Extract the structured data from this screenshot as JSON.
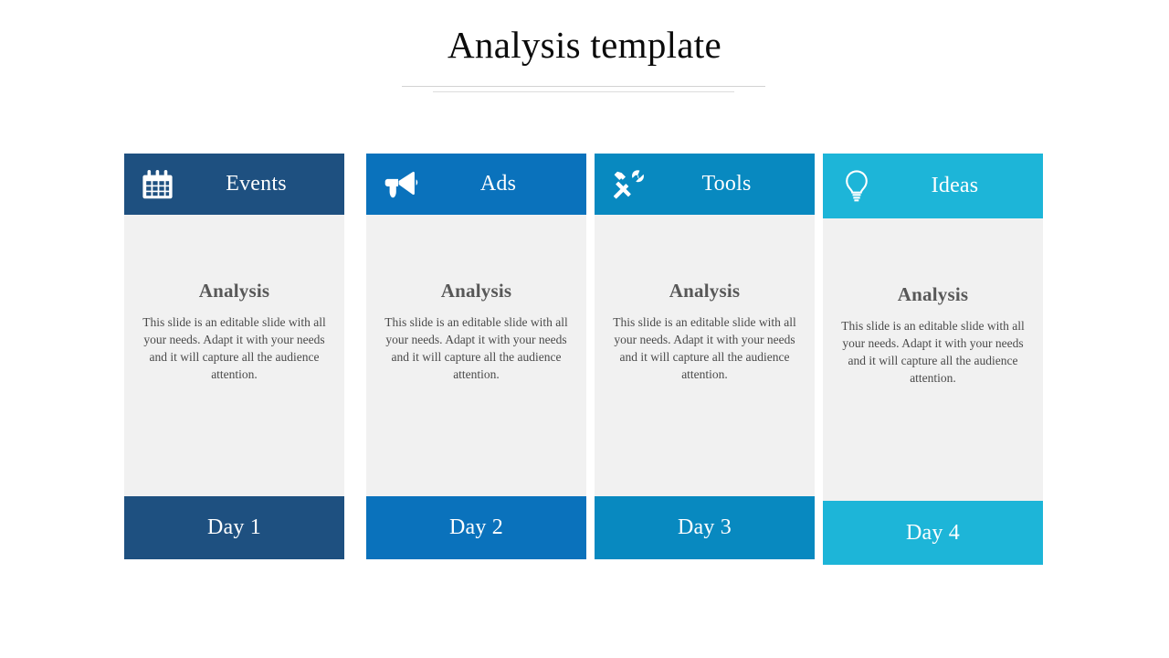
{
  "slide": {
    "title": "Analysis template",
    "background_color": "#FFFFFF",
    "rule_color": "#D2D2D2"
  },
  "cards": [
    {
      "header_label": "Events",
      "icon": "calendar-icon",
      "header_color": "#1E5080",
      "body_color": "#F1F1F1",
      "footer_color": "#1E5080",
      "body_heading": "Analysis",
      "body_text": "This slide is an editable slide with all your needs. Adapt it with your needs and it will capture all the audience attention.",
      "footer_label": "Day 1"
    },
    {
      "header_label": "Ads",
      "icon": "megaphone-icon",
      "header_color": "#0A72BC",
      "body_color": "#F1F1F1",
      "footer_color": "#0A72BC",
      "body_heading": "Analysis",
      "body_text": "This slide is an editable slide with all your needs. Adapt it with your needs and it will capture all the audience attention.",
      "footer_label": "Day 2"
    },
    {
      "header_label": "Tools",
      "icon": "hammer-wrench-icon",
      "header_color": "#0889C0",
      "body_color": "#F1F1F1",
      "footer_color": "#0889C0",
      "body_heading": "Analysis",
      "body_text": "This slide is an editable slide with all your needs. Adapt it with your needs and it will capture all the audience attention.",
      "footer_label": "Day 3"
    },
    {
      "header_label": "Ideas",
      "icon": "lightbulb-icon",
      "header_color": "#1DB5D8",
      "body_color": "#F1F1F1",
      "footer_color": "#1DB5D8",
      "body_heading": "Analysis",
      "body_text": "This slide is an editable slide with all your needs. Adapt it with your needs and it will capture all the audience attention.",
      "footer_label": "Day 4"
    }
  ]
}
